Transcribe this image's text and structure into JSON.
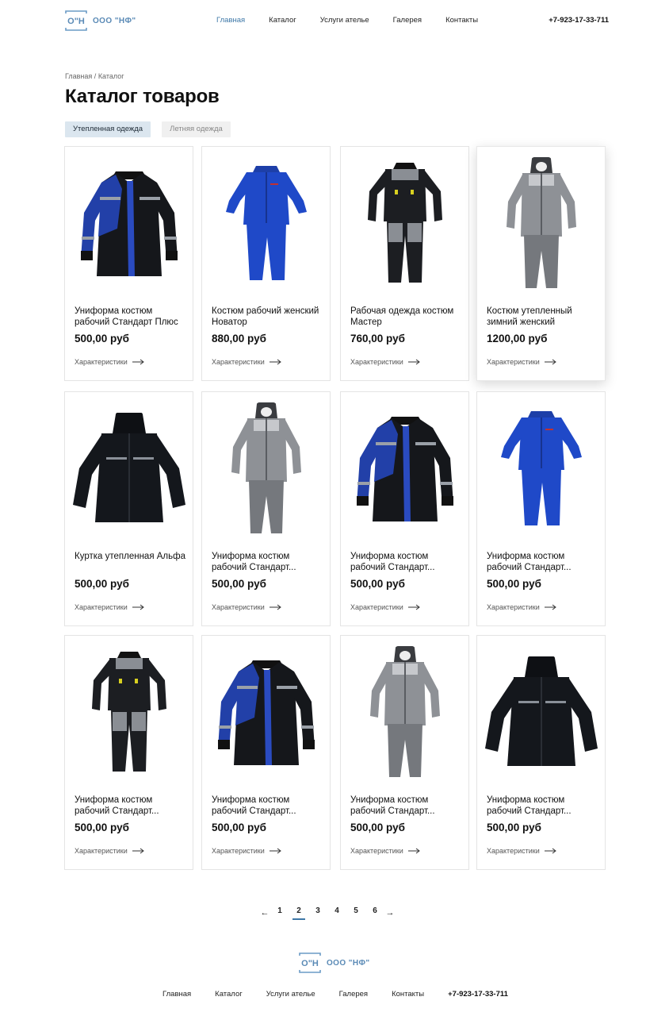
{
  "header": {
    "logo_mark": "О\"Н",
    "logo_text": "ООО \"НФ\"",
    "nav": [
      {
        "label": "Главная",
        "active": true
      },
      {
        "label": "Каталог",
        "active": false
      },
      {
        "label": "Услуги ателье",
        "active": false
      },
      {
        "label": "Галерея",
        "active": false
      },
      {
        "label": "Контакты",
        "active": false
      }
    ],
    "phone": "+7-923-17-33-711"
  },
  "breadcrumb": {
    "home": "Главная",
    "separator": "/",
    "current": "Каталог"
  },
  "page_title": "Каталог товаров",
  "tabs": [
    {
      "label": "Утепленная одежда",
      "active": true
    },
    {
      "label": "Летняя одежда",
      "active": false
    }
  ],
  "products": [
    {
      "title": "Униформа костюм рабочий Стандарт Плюс",
      "price": "500,00 руб",
      "specs": "Характеристики",
      "image": "jacket-blue-black"
    },
    {
      "title": "Костюм рабочий женский Новатор",
      "price": "880,00 руб",
      "specs": "Характеристики",
      "image": "suit-blue"
    },
    {
      "title": "Рабочая одежда костюм Мастер",
      "price": "760,00 руб",
      "specs": "Характеристики",
      "image": "suit-black-gray"
    },
    {
      "title": "Костюм утепленный зимний женский",
      "price": "1200,00 руб",
      "specs": "Характеристики",
      "image": "suit-gray-hood"
    },
    {
      "title": "Куртка утепленная Альфа",
      "price": "500,00 руб",
      "specs": "Характеристики",
      "image": "parka-black"
    },
    {
      "title": "Униформа костюм рабочий Стандарт...",
      "price": "500,00 руб",
      "specs": "Характеристики",
      "image": "suit-gray-hood"
    },
    {
      "title": "Униформа костюм рабочий Стандарт...",
      "price": "500,00 руб",
      "specs": "Характеристики",
      "image": "jacket-blue-black"
    },
    {
      "title": "Униформа костюм рабочий Стандарт...",
      "price": "500,00 руб",
      "specs": "Характеристики",
      "image": "suit-blue"
    },
    {
      "title": "Униформа костюм рабочий Стандарт...",
      "price": "500,00 руб",
      "specs": "Характеристики",
      "image": "suit-black-gray"
    },
    {
      "title": "Униформа костюм рабочий Стандарт...",
      "price": "500,00 руб",
      "specs": "Характеристики",
      "image": "jacket-blue-black"
    },
    {
      "title": "Униформа костюм рабочий Стандарт...",
      "price": "500,00 руб",
      "specs": "Характеристики",
      "image": "suit-gray-hood"
    },
    {
      "title": "Униформа костюм рабочий Стандарт...",
      "price": "500,00 руб",
      "specs": "Характеристики",
      "image": "parka-black"
    }
  ],
  "pagination": {
    "prev": "←",
    "next": "→",
    "pages": [
      "1",
      "2",
      "3",
      "4",
      "5",
      "6"
    ],
    "current": "2"
  },
  "footer": {
    "logo_mark": "О\"Н",
    "logo_text": "ООО \"НФ\"",
    "nav": [
      "Главная",
      "Каталог",
      "Услуги ателье",
      "Галерея",
      "Контакты"
    ],
    "phone": "+7-923-17-33-711"
  },
  "colors": {
    "accent": "#3e78a8",
    "logo": "#5a8ab6",
    "tab_active_bg": "#dbe6ef",
    "tab_inactive_bg": "#f0f0f0"
  }
}
